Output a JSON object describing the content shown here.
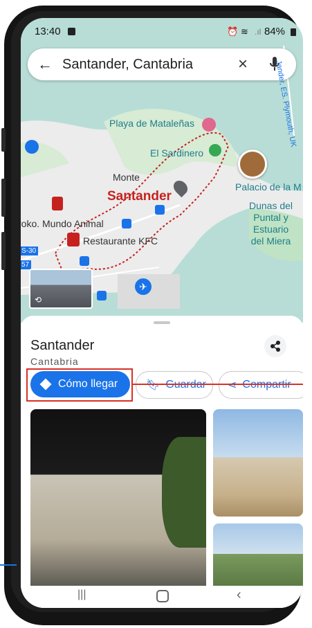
{
  "statusbar": {
    "time": "13:40",
    "battery": "84%"
  },
  "search": {
    "query": "Santander, Cantabria"
  },
  "map": {
    "labels": {
      "playa": "Playa de Mataleñas",
      "sardinero": "El Sardinero",
      "monte": "Monte",
      "santander": "Santander",
      "palacio": "Palacio de la M",
      "dunas": "Dunas del\nPuntal y\nEstuario\ndel Miera",
      "roko": "roko. Mundo Animal",
      "kfc": "Restaurante KFC",
      "s30": "S-30",
      "road57": "57",
      "side_road": "Jander, ES. Plymouth, UK"
    }
  },
  "place": {
    "title": "Santander",
    "subtitle": "Cantabria"
  },
  "actions": {
    "directions": "Cómo llegar",
    "save": "Guardar",
    "share": "Compartir"
  },
  "colors": {
    "accent": "#1a73e8",
    "highlight": "#d93025",
    "route": "#c5221f"
  }
}
